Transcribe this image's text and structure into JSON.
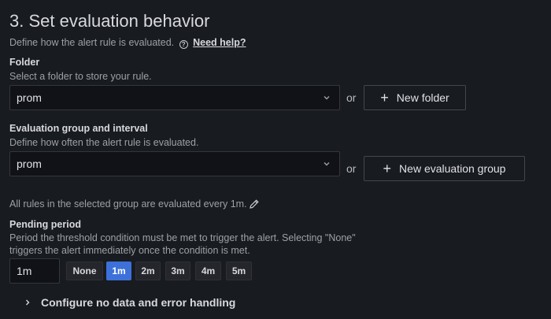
{
  "section": {
    "title": "3. Set evaluation behavior",
    "description": "Define how the alert rule is evaluated.",
    "help_link": "Need help?"
  },
  "folder": {
    "label": "Folder",
    "description": "Select a folder to store your rule.",
    "value": "prom",
    "or_text": "or",
    "new_button": "New folder"
  },
  "group": {
    "label": "Evaluation group and interval",
    "description": "Define how often the alert rule is evaluated.",
    "value": "prom",
    "or_text": "or",
    "new_button": "New evaluation group",
    "info": "All rules in the selected group are evaluated every 1m."
  },
  "pending": {
    "label": "Pending period",
    "description_line1": "Period the threshold condition must be met to trigger the alert. Selecting \"None\"",
    "description_line2": "triggers the alert immediately once the condition is met.",
    "value": "1m",
    "options": [
      "None",
      "1m",
      "2m",
      "3m",
      "4m",
      "5m"
    ],
    "selected": "1m"
  },
  "no_data": {
    "title": "Configure no data and error handling"
  },
  "colors": {
    "background": "#181b1f",
    "accent": "#3d71d9"
  }
}
